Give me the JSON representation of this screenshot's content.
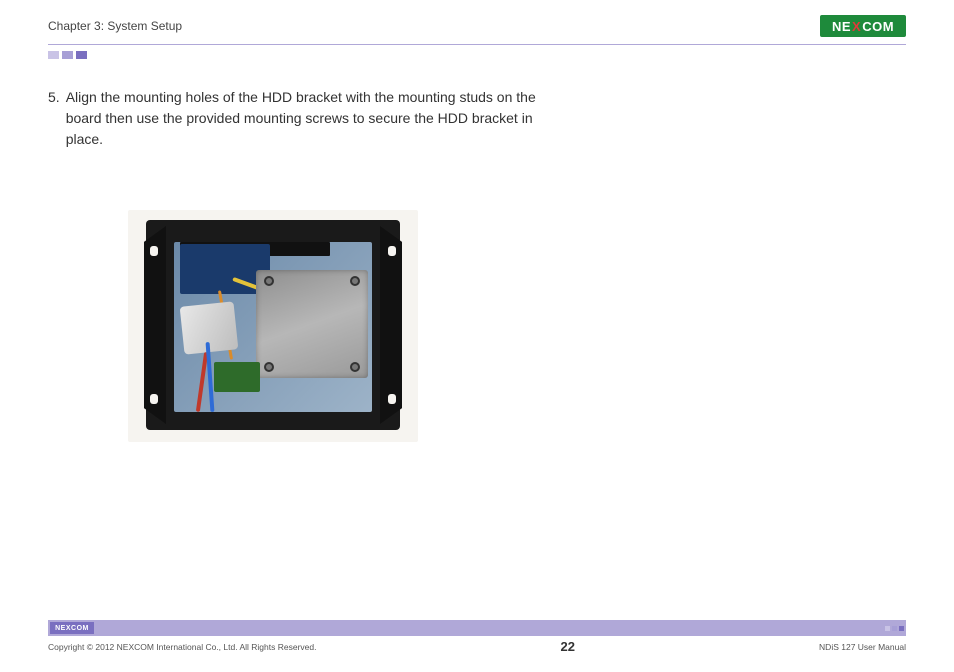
{
  "header": {
    "chapter": "Chapter 3: System Setup",
    "logo_left": "NE",
    "logo_x": "X",
    "logo_right": "COM"
  },
  "step": {
    "number": "5.",
    "text": "Align the mounting holes of the HDD bracket with the mounting studs on the board then use the provided mounting screws to secure the HDD bracket in place."
  },
  "footer": {
    "logo_left": "NE",
    "logo_x": "X",
    "logo_right": "COM",
    "copyright": "Copyright © 2012 NEXCOM International Co., Ltd. All Rights Reserved.",
    "page": "22",
    "doc": "NDiS 127 User Manual"
  }
}
